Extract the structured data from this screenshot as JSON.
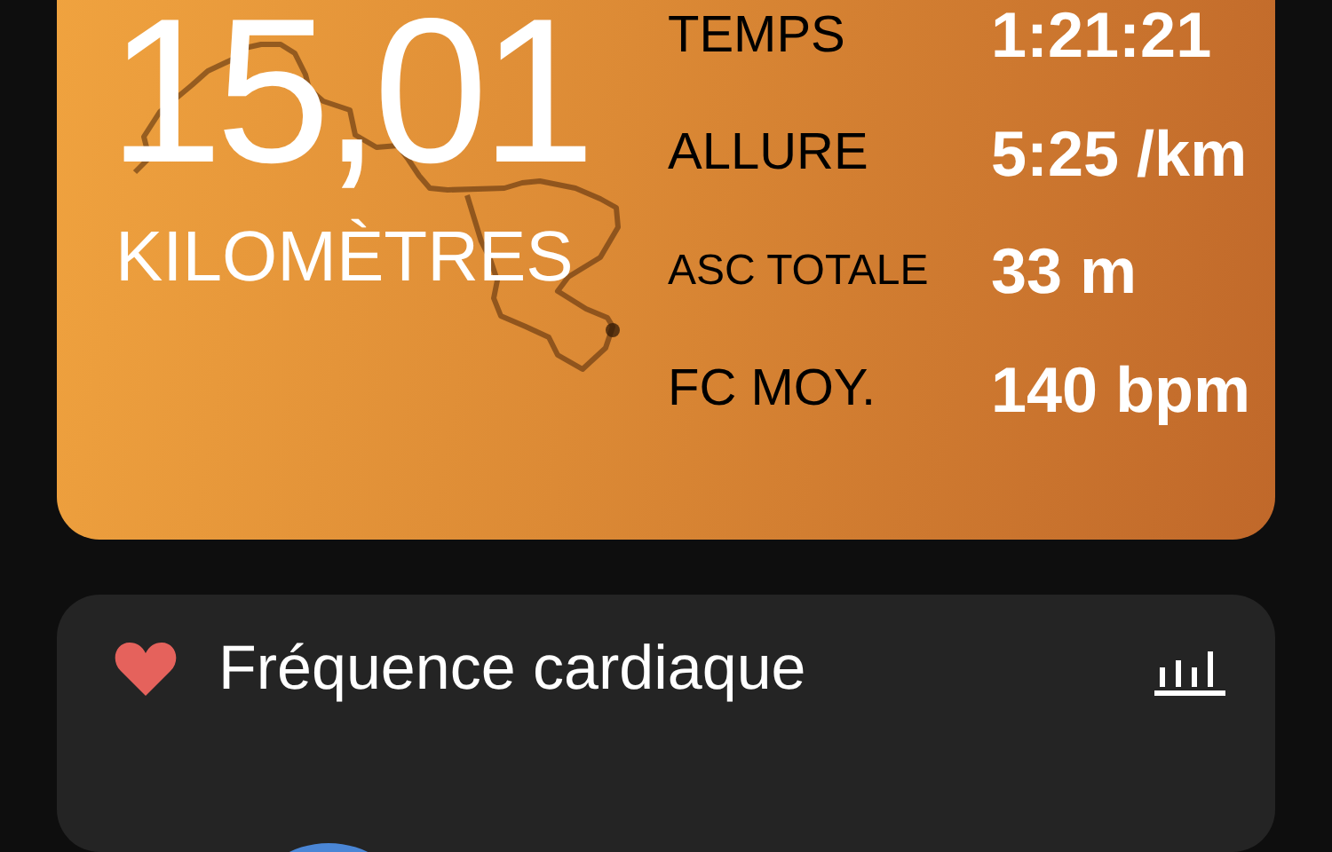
{
  "summary": {
    "distance": "15,01",
    "unit": "KILOMÈTRES",
    "stats": [
      {
        "kind": "regular",
        "label": "TEMPS",
        "value": "1:21:21"
      },
      {
        "kind": "regular",
        "label": "ALLURE",
        "value": "5:25 /km"
      },
      {
        "kind": "compact",
        "label": "ASC TOTALE",
        "value": "33 m"
      },
      {
        "kind": "regular",
        "label": "FC MOY.",
        "value": "140 bpm"
      }
    ]
  },
  "heart_rate_card": {
    "title": "Fréquence cardiaque"
  }
}
